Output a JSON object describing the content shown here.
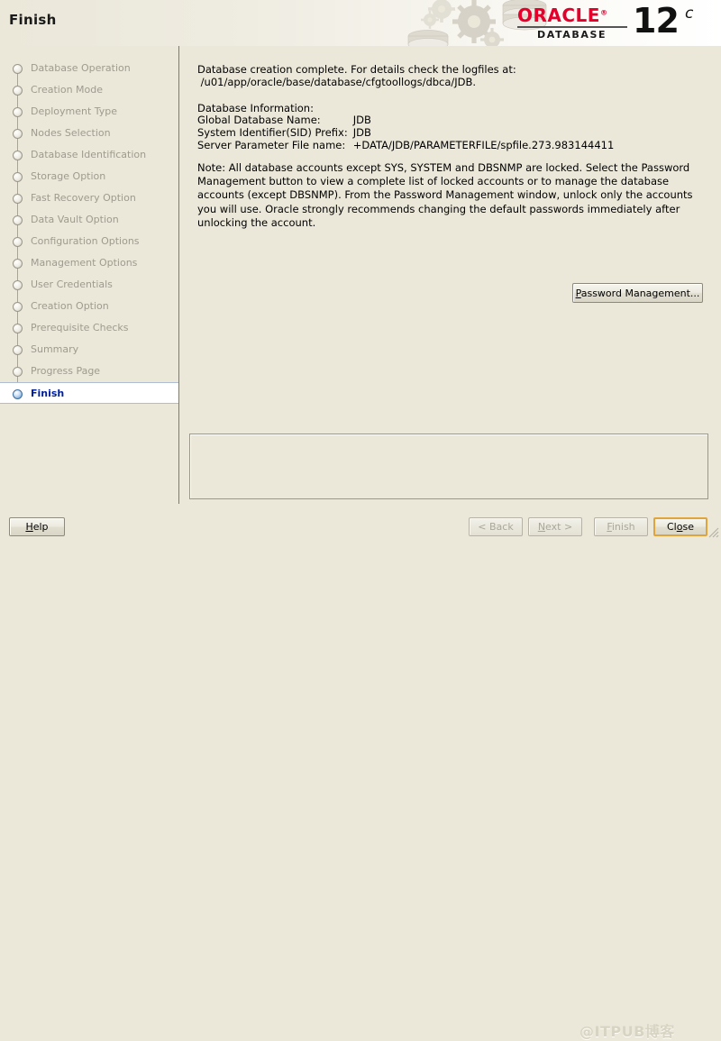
{
  "window": {
    "title": "Finish"
  },
  "branding": {
    "oracle_word": "ORACLE",
    "registered_mark": "®",
    "database_word": "DATABASE",
    "version_number": "12",
    "version_suffix": "c",
    "brand_red": "#e4002b"
  },
  "sidebar": {
    "items": [
      {
        "label": "Database Operation",
        "state": "done"
      },
      {
        "label": "Creation Mode",
        "state": "done"
      },
      {
        "label": "Deployment Type",
        "state": "done"
      },
      {
        "label": "Nodes Selection",
        "state": "done"
      },
      {
        "label": "Database Identification",
        "state": "done"
      },
      {
        "label": "Storage Option",
        "state": "done"
      },
      {
        "label": "Fast Recovery Option",
        "state": "done"
      },
      {
        "label": "Data Vault Option",
        "state": "done"
      },
      {
        "label": "Configuration Options",
        "state": "done"
      },
      {
        "label": "Management Options",
        "state": "done"
      },
      {
        "label": "User Credentials",
        "state": "done"
      },
      {
        "label": "Creation Option",
        "state": "done"
      },
      {
        "label": "Prerequisite Checks",
        "state": "done"
      },
      {
        "label": "Summary",
        "state": "done"
      },
      {
        "label": "Progress Page",
        "state": "done"
      },
      {
        "label": "Finish",
        "state": "active"
      }
    ],
    "active_color": "#00209f",
    "inactive_color": "#9e9b8e"
  },
  "main": {
    "completion_message": "Database creation complete. For details check the logfiles at:\n /u01/app/oracle/base/database/cfgtoollogs/dbca/JDB.",
    "info_heading": "Database Information:",
    "info_rows": [
      {
        "key": "Global Database Name:",
        "value": "JDB"
      },
      {
        "key": "System Identifier(SID) Prefix:",
        "value": "JDB"
      },
      {
        "key": "Server Parameter File name:",
        "value": "+DATA/JDB/PARAMETERFILE/spfile.273.983144411"
      }
    ],
    "note": "Note: All database accounts except SYS, SYSTEM and DBSNMP are locked. Select the Password Management button to view a complete list of locked accounts or to manage the database accounts (except DBSNMP). From the Password Management window, unlock only the accounts you will use. Oracle strongly recommends changing the default passwords immediately after unlocking the account.",
    "password_management_button": "Password Management..."
  },
  "footer": {
    "help_label": "Help",
    "back_label": "< Back",
    "next_label": "Next >",
    "finish_label": "Finish",
    "close_label": "Close",
    "watermark": "@ITPUB博客",
    "focus_ring_color": "#e0a43c"
  }
}
